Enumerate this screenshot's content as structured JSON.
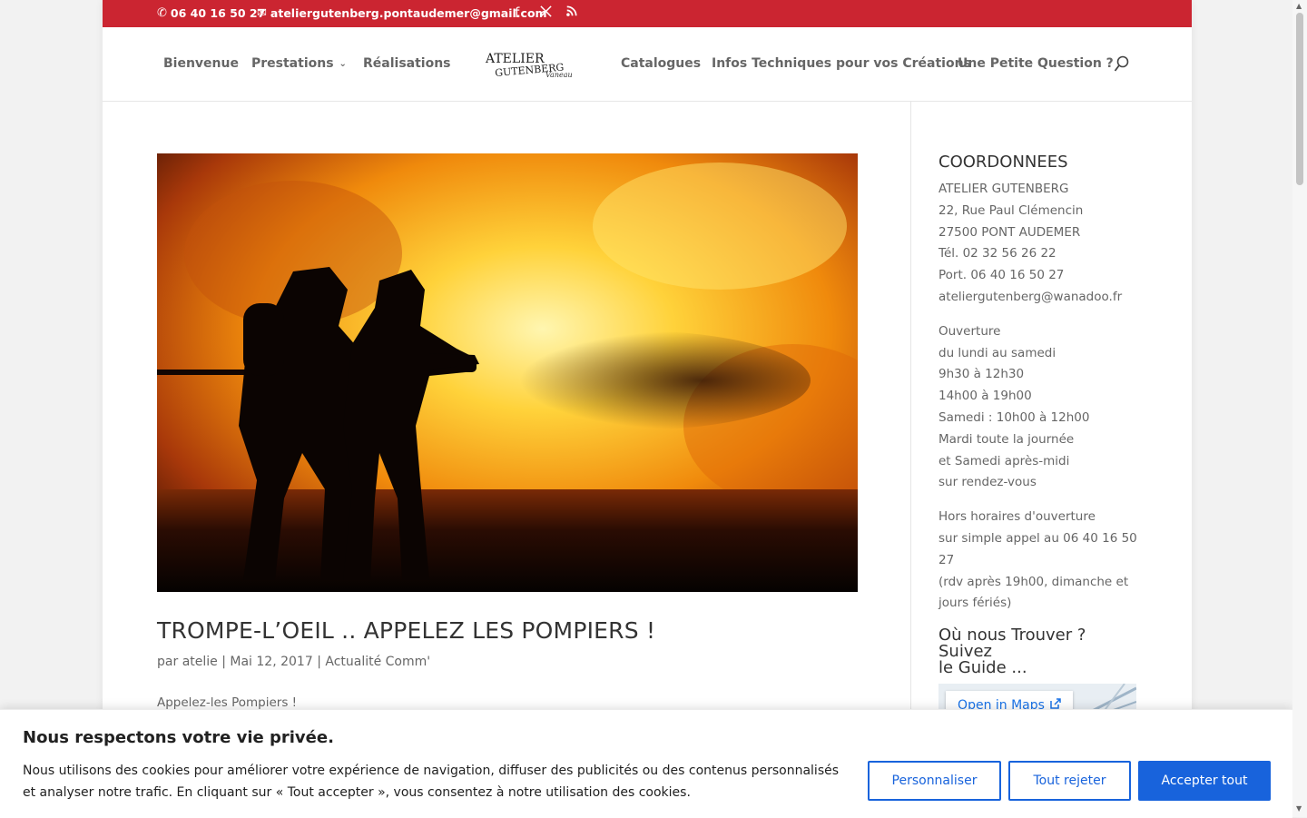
{
  "topbar": {
    "phone": "06 40 16 50 27",
    "email": "ateliergutenberg.pontaudemer@gmail.com",
    "bg_color": "#cb2531"
  },
  "nav": {
    "items": [
      {
        "label": "Bienvenue"
      },
      {
        "label": "Prestations",
        "has_dropdown": true
      },
      {
        "label": "Réalisations"
      },
      {
        "label": "Catalogues"
      },
      {
        "label": "Infos Techniques pour vos Créations"
      },
      {
        "label": "Une Petite Question ?"
      }
    ]
  },
  "logo": {
    "line1": "ATELIER",
    "line2": "GUTENBERG",
    "script": "Vaneau"
  },
  "post": {
    "title": "TROMPE-L’OEIL .. APPELEZ LES POMPIERS !",
    "meta_prefix": "par",
    "author": "atelie",
    "sep": "|",
    "date": "Mai 12, 2017",
    "category": "Actualité Comm'",
    "excerpt": "Appelez-les Pompiers !"
  },
  "sidebar": {
    "heading": "COORDONNEES",
    "address": [
      "ATELIER GUTENBERG",
      "22, Rue Paul Clémencin",
      "27500 PONT AUDEMER",
      "Tél. 02 32 56 26 22",
      "Port. 06 40 16 50 27",
      "ateliergutenberg@wanadoo.fr"
    ],
    "hours": [
      "Ouverture",
      "du lundi au samedi",
      "9h30 à 12h30",
      "14h00 à 19h00",
      "Samedi : 10h00 à 12h00",
      "Mardi toute la journée",
      "et Samedi après-midi",
      "sur rendez-vous"
    ],
    "after_hours": [
      "Hors horaires d'ouverture",
      "sur simple appel au 06 40 16 50",
      "27",
      "(rdv après 19h00, dimanche et",
      "jours fériés)"
    ],
    "guide_heading_1": "Où nous Trouver ? Suivez",
    "guide_heading_2": "le Guide ...",
    "map_button": "Open in Maps"
  },
  "cookie": {
    "title": "Nous respectons votre vie privée.",
    "text": "Nous utilisons des cookies pour améliorer votre expérience de navigation, diffuser des publicités ou des contenus personnalisés et analyser notre trafic. En cliquant sur « Tout accepter », vous consentez à notre utilisation des cookies.",
    "customize_label": "Personnaliser",
    "reject_label": "Tout rejeter",
    "accept_label": "Accepter tout",
    "accent_color": "#1863dc"
  }
}
